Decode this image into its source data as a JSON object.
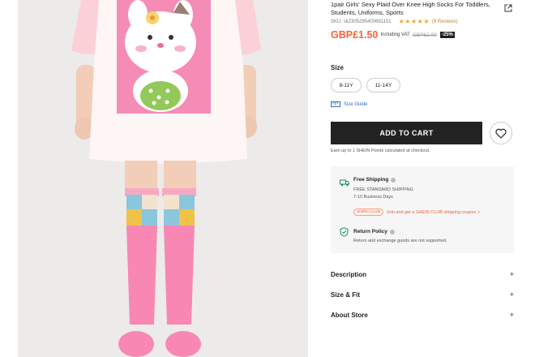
{
  "product": {
    "title": "1pair Girls' Sexy Plaid Over Knee High Socks For Toddlers, Students, Uniforms, Sports",
    "sku": "SKU: sk2305295400691151",
    "stars": "★★★★★",
    "reviews": "(9 Reviews)",
    "price": "GBP£1.50",
    "including_vat": "Including VAT",
    "original_price": "GBP£2.00",
    "discount": "-25%"
  },
  "size": {
    "label": "Size",
    "options": [
      "8-11Y",
      "11-14Y"
    ],
    "guide": "Size Guide"
  },
  "actions": {
    "add_to_cart": "ADD TO CART",
    "points": "Earn up to 1 SHEIN Points calculated at checkout."
  },
  "shipping": {
    "title": "Free Shipping",
    "standard": "FREE STANDARD SHIPPING",
    "days": "7-10 Business Days",
    "club_badge": "SHEIN CLUB",
    "club_text": "Join and get a SHEIN CLUB shipping coupon >"
  },
  "returns": {
    "title": "Return Policy",
    "text": "Return and exchange goods are not supported."
  },
  "sections": [
    "Description",
    "Size & Fit",
    "About Store"
  ],
  "colors": {
    "price": "#fa6338",
    "accent_dark": "#222222",
    "link": "#2b6cc4",
    "club": "#e8623a",
    "star": "#f5a623"
  },
  "icons": [
    "share-icon",
    "ruler-icon",
    "heart-icon",
    "truck-icon",
    "info-icon",
    "shield-check-icon",
    "plus-icon"
  ]
}
